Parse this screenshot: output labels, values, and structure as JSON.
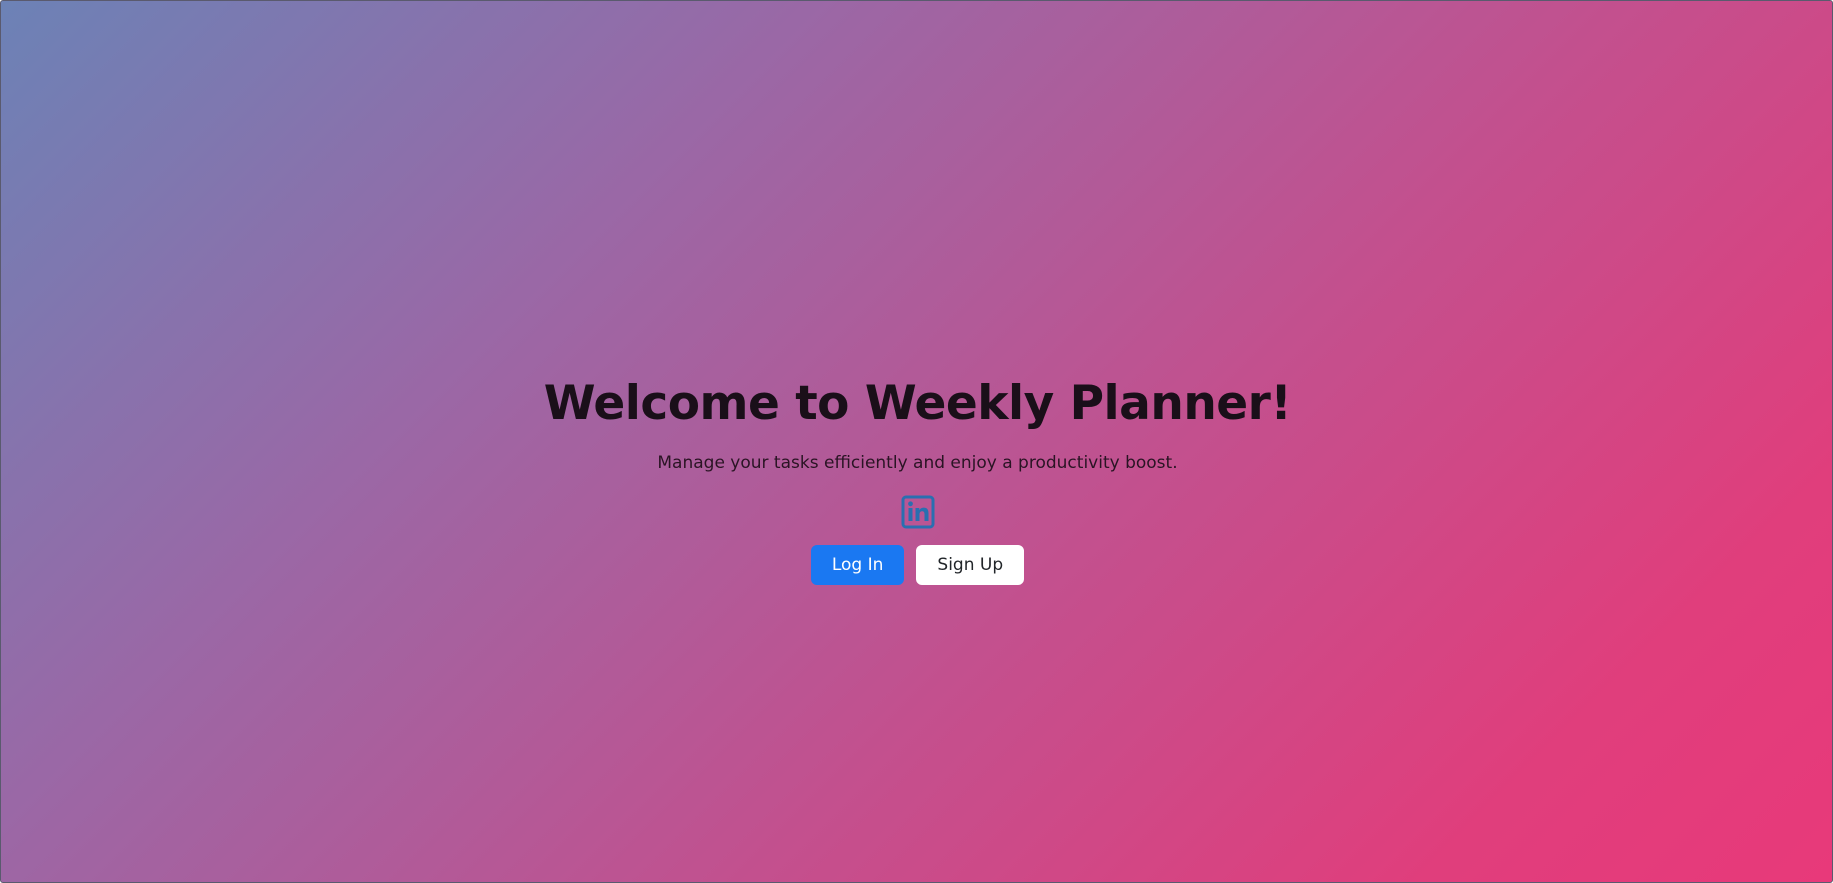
{
  "hero": {
    "title": "Welcome to Weekly Planner!",
    "subtitle": "Manage your tasks efficiently and enjoy a productivity boost.",
    "icon": "linkedin-icon"
  },
  "actions": {
    "login_label": "Log In",
    "signup_label": "Sign Up"
  },
  "colors": {
    "gradient_start": "#6c82b6",
    "gradient_end": "#e8397a",
    "primary_button": "#1a78f2",
    "secondary_button": "#ffffff",
    "linkedin_icon": "#2a6fb0"
  }
}
